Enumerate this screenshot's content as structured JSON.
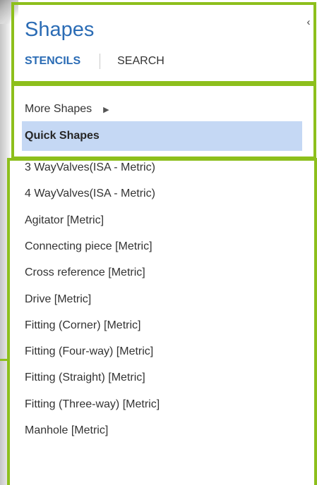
{
  "pane": {
    "title": "Shapes",
    "collapse_glyph": "‹"
  },
  "tabs": {
    "stencils": "STENCILS",
    "search": "SEARCH"
  },
  "menu": {
    "more_shapes": "More Shapes",
    "more_shapes_arrow": "▶",
    "quick_shapes": "Quick Shapes"
  },
  "stencils": [
    "3 WayValves(ISA - Metric)",
    "4 WayValves(ISA - Metric)",
    "Agitator [Metric]",
    "Connecting piece [Metric]",
    "Cross reference [Metric]",
    "Drive [Metric]",
    "Fitting (Corner) [Metric]",
    "Fitting (Four-way) [Metric]",
    "Fitting (Straight) [Metric]",
    "Fitting (Three-way) [Metric]",
    "Manhole [Metric]"
  ],
  "colors": {
    "title_blue": "#2b6cb5",
    "highlight_green": "#8dbf1c",
    "selected_bg": "#c5d8f4"
  }
}
